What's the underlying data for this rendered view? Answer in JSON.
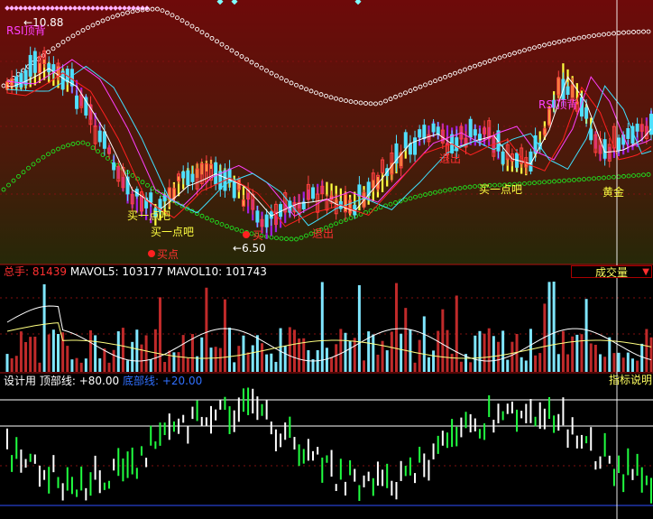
{
  "panel_top": {
    "price_high": "10.88",
    "price_low": "6.50",
    "annotations": {
      "rsi_top_left": "RSI顶背",
      "rsi_top_right": "RSI顶背",
      "buy_a_bit_1": "买一点吧",
      "buy_a_bit_2": "买一点吧",
      "buy_a_bit_3": "买一点吧",
      "buy_point": "买点",
      "buy": "买",
      "retreat_1": "退出",
      "retreat_2": "退出",
      "golden_cross": "黄金"
    }
  },
  "panel_volume": {
    "total_label": "总手:",
    "total_value": "81439",
    "mavol5_label": "MAVOL5:",
    "mavol5_value": "103177",
    "mavol10_label": "MAVOL10:",
    "mavol10_value": "101743",
    "indicator_select": "成交量"
  },
  "panel_osc": {
    "designer_label": "设计用",
    "top_line_label": "顶部线:",
    "top_line_value": "+80.00",
    "bottom_line_label": "底部线:",
    "bottom_line_value": "+20.00",
    "help_button": "指标说明"
  },
  "colors": {
    "bg_grad_top": "#6e0a0a",
    "bg_grad_bottom": "#2a2a08",
    "candle_up": "#ff4040",
    "candle_down": "#50e0ff",
    "vol_up": "#c02a2a",
    "vol_down": "#7fe6ff",
    "ma_white": "#ffffff",
    "ma_magenta": "#ff40ff",
    "ma_cyan": "#40e0ff",
    "ma_red": "#ff2020",
    "ribbon_yellow": "#ffff40",
    "ribbon_purple": "#a020e0",
    "green_dots": "#20e020",
    "white_dots": "#ffffff",
    "osc_green": "#20ff40"
  }
}
